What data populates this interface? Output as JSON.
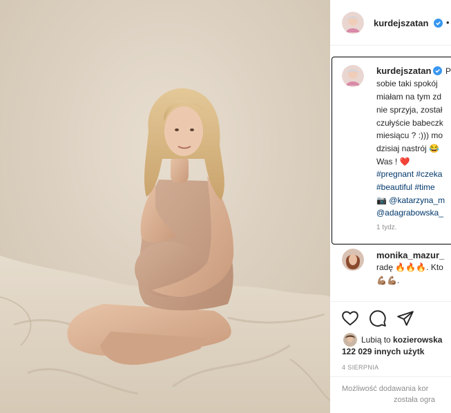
{
  "post": {
    "author": "kurdejszatan",
    "more_dots": "•"
  },
  "caption": {
    "author": "kurdejszatan",
    "lines": [
      "P",
      "sobie taki spokój",
      "miałam na tym zd",
      "nie sprzyja, został",
      "czułyście babeczk",
      "miesiącu ? :))) mo",
      "dzisiaj nastrój 😂",
      "Was ! ❤️"
    ],
    "hashtags_line1": "#pregnant #czeka",
    "hashtags_line2": "#beautiful #time",
    "credit_line1": "📷 @katarzyna_m",
    "credit_line2": "@adagrabowska_",
    "time_ago": "1 tydz."
  },
  "comment": {
    "author": "monika_mazur_",
    "line1": "radę 🔥🔥🔥. Kto",
    "line2": "💪🏽💪🏽."
  },
  "likes": {
    "prefix": "Lubią to ",
    "liker": "kozierowska",
    "others": "122 029 innych użytk"
  },
  "date": "4 SIERPNIA",
  "comments_disabled": {
    "line1": "Możliwość dodawania kor",
    "line2": "została ogra"
  },
  "colors": {
    "verified": "#3897f0",
    "hashtag": "#00376b",
    "heart": "#ed4956"
  }
}
